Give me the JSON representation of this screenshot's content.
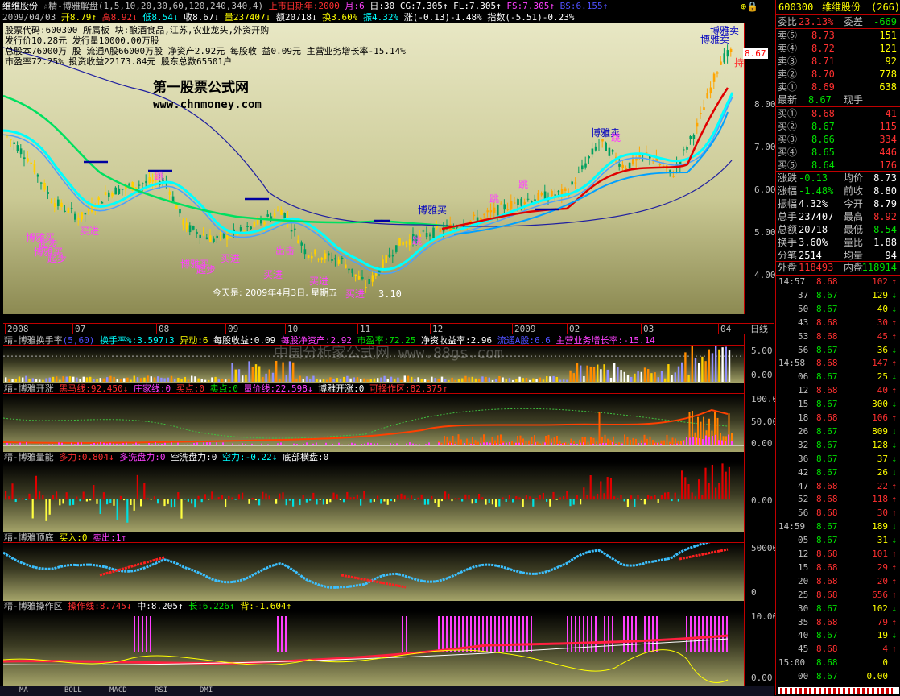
{
  "header": {
    "line1": [
      {
        "t": "维维股份",
        "c": "#ffffff"
      },
      {
        "t": " ☆精-博雅解盘(1,5,10,20,30,60,120,240,340,4)",
        "c": "#c0c0c0"
      },
      {
        "t": " 上市日期年:2000",
        "c": "#ff3030"
      },
      {
        "t": " 月:6",
        "c": "#ff40ff"
      },
      {
        "t": " 日:30",
        "c": "#ffffff"
      },
      {
        "t": " CG:7.305↑",
        "c": "#ffffff"
      },
      {
        "t": " FL:7.305↑",
        "c": "#ffffff"
      },
      {
        "t": " FS:7.305↑",
        "c": "#ff40ff"
      },
      {
        "t": " BS:6.155↑",
        "c": "#5050ff"
      }
    ],
    "line2": [
      {
        "t": "2009/04/03",
        "c": "#c0c0c0"
      },
      {
        "t": " 开8.79↑",
        "c": "#ffff00"
      },
      {
        "t": " 高8.92↓",
        "c": "#ff3030"
      },
      {
        "t": " 低8.54↓",
        "c": "#00ffff"
      },
      {
        "t": " 收8.67↓",
        "c": "#ffffff"
      },
      {
        "t": " 量237407↓",
        "c": "#ffff00"
      },
      {
        "t": " 额20718↓",
        "c": "#ffffff"
      },
      {
        "t": " 换3.60%",
        "c": "#ffff00"
      },
      {
        "t": " 振4.32%",
        "c": "#00ffff"
      },
      {
        "t": " 涨(-0.13)-1.48%",
        "c": "#ffffff"
      },
      {
        "t": " 指数(-5.51)-0.23%",
        "c": "#ffffff"
      }
    ]
  },
  "info_lines": [
    "股票代码:600300 所属板 块:酿酒食品,江苏,农业龙头,外资开购",
    "发行价10.28元  发行量10000.00万股",
    "总股本76000万 股  流通A股66000万股    净资产2.92元   每股收 益0.09元   主营业务增长率-15.14%",
    "市盈率72.25%  投资收益22173.84元  股东总数65501户"
  ],
  "watermark": {
    "title": "第一股票公式网",
    "url": "www.chnmoney.com",
    "mid": "中国分析家公式网 www.88gs.com"
  },
  "annotations": {
    "today": "今天是: 2009年4月3日, 星期五",
    "low_value": "3.10",
    "buy": "买进",
    "boya_buy": "博雅买",
    "boya_sell": "博雅卖",
    "start": "起步",
    "tiao": "跳",
    "chuji": "出击",
    "hold": "持",
    "price_tag": "8.67"
  },
  "main_axis": {
    "labels": [
      "8.00",
      "7.00",
      "6.00",
      "5.00",
      "4.00"
    ]
  },
  "x_axis": {
    "labels": [
      "2008",
      "07",
      "08",
      "09",
      "10",
      "11",
      "12",
      "2009",
      "02",
      "03",
      "04"
    ],
    "period": "日线"
  },
  "panels": [
    {
      "key": "turnover",
      "title": [
        {
          "t": "精-博雅换手率",
          "c": "#c0c0c0"
        },
        {
          "t": "(5,60)",
          "c": "#5050ff"
        },
        {
          "t": "  换手率%:3.597↓3",
          "c": "#00ffff"
        },
        {
          "t": "  异动:6",
          "c": "#ffff00"
        },
        {
          "t": "  每股收益:0.09",
          "c": "#ffffff"
        },
        {
          "t": "  每股净资产:2.92",
          "c": "#ff40ff"
        },
        {
          "t": "  市盈率:72.25",
          "c": "#00e000"
        },
        {
          "t": "  净资收益率:2.96",
          "c": "#ffffff"
        },
        {
          "t": "  流通A股:6.6",
          "c": "#5050ff"
        },
        {
          "t": "  主营业务增长率:-15.14",
          "c": "#ff40ff"
        }
      ],
      "axis": [
        "5.00",
        "0.00"
      ]
    },
    {
      "key": "kaizhang",
      "title": [
        {
          "t": "精-博雅开涨",
          "c": "#c0c0c0"
        },
        {
          "t": "  黑马线:92.450↓",
          "c": "#ff3030"
        },
        {
          "t": "  庄家线:0",
          "c": "#ff40ff"
        },
        {
          "t": "  买点:0",
          "c": "#ff3030"
        },
        {
          "t": "  卖点:0",
          "c": "#00e000"
        },
        {
          "t": "  量价线:22.598↓",
          "c": "#ff40ff"
        },
        {
          "t": "  博雅开涨:0",
          "c": "#ffffff"
        },
        {
          "t": "  可操作区:82.375↑",
          "c": "#ff3030"
        }
      ],
      "axis": [
        "100.00",
        "50.00",
        "0.00"
      ]
    },
    {
      "key": "liangneng",
      "title": [
        {
          "t": "精-博雅量能",
          "c": "#c0c0c0"
        },
        {
          "t": "  多力:0.804↓",
          "c": "#ff3030"
        },
        {
          "t": "  多洗盘力:0",
          "c": "#ff40ff"
        },
        {
          "t": "  空洗盘力:0",
          "c": "#ffffff"
        },
        {
          "t": "  空力:-0.22↓",
          "c": "#00ffff"
        },
        {
          "t": "  底部横盘:0",
          "c": "#ffffff"
        }
      ],
      "axis": [
        "0.00"
      ]
    },
    {
      "key": "dingdi",
      "title": [
        {
          "t": "精-博雅顶底",
          "c": "#c0c0c0"
        },
        {
          "t": "  买入:0",
          "c": "#ffff00"
        },
        {
          "t": "  卖出:1↑",
          "c": "#ff40ff"
        }
      ],
      "axis": [
        "50000",
        "0"
      ]
    },
    {
      "key": "caozuo",
      "title": [
        {
          "t": "精-博雅操作区",
          "c": "#c0c0c0"
        },
        {
          "t": "  操作线:8.745↓",
          "c": "#ff3030"
        },
        {
          "t": "  中:8.205↑",
          "c": "#ffffff"
        },
        {
          "t": "  长:6.226↑",
          "c": "#00e000"
        },
        {
          "t": "  背:-1.604↑",
          "c": "#ffff00"
        }
      ],
      "axis": [
        "10.00",
        "0.00"
      ]
    }
  ],
  "bottom_tabs": [
    "MA",
    "BOLL",
    "MACD",
    "RSI",
    "DMI"
  ],
  "quote": {
    "code": "600300",
    "name": "维维股份",
    "count": "(266)",
    "wei_bi": {
      "label": "委比",
      "value": "23.13%"
    },
    "wei_cha": {
      "label": "委差",
      "value": "-669"
    },
    "asks": [
      {
        "label": "卖⑤",
        "price": "8.73",
        "vol": "151"
      },
      {
        "label": "卖④",
        "price": "8.72",
        "vol": "121"
      },
      {
        "label": "卖③",
        "price": "8.71",
        "vol": "92"
      },
      {
        "label": "卖②",
        "price": "8.70",
        "vol": "778"
      },
      {
        "label": "卖①",
        "price": "8.69",
        "vol": "638"
      }
    ],
    "latest": {
      "label": "最新",
      "price": "8.67",
      "label2": "现手"
    },
    "bids": [
      {
        "label": "买①",
        "price": "8.68",
        "vol": "41"
      },
      {
        "label": "买②",
        "price": "8.67",
        "vol": "115"
      },
      {
        "label": "买③",
        "price": "8.66",
        "vol": "334"
      },
      {
        "label": "买④",
        "price": "8.65",
        "vol": "446"
      },
      {
        "label": "买⑤",
        "price": "8.64",
        "vol": "176"
      }
    ],
    "stats": [
      {
        "l1": "涨跌",
        "v1": "-0.13",
        "l2": "均价",
        "v2": "8.73",
        "c1": "#00e000",
        "c2": "#ffffff"
      },
      {
        "l1": "涨幅",
        "v1": "-1.48%",
        "l2": "前收",
        "v2": "8.80",
        "c1": "#00e000",
        "c2": "#ffffff"
      },
      {
        "l1": "振幅",
        "v1": "4.32%",
        "l2": "今开",
        "v2": "8.79",
        "c1": "#ffffff",
        "c2": "#ffffff"
      },
      {
        "l1": "总手",
        "v1": "237407",
        "l2": "最高",
        "v2": "8.92",
        "c1": "#ffffff",
        "c2": "#ff3030"
      },
      {
        "l1": "总额",
        "v1": "20718",
        "l2": "最低",
        "v2": "8.54",
        "c1": "#ffffff",
        "c2": "#00e000"
      },
      {
        "l1": "换手",
        "v1": "3.60%",
        "l2": "量比",
        "v2": "1.88",
        "c1": "#ffffff",
        "c2": "#ffffff"
      },
      {
        "l1": "分笔",
        "v1": "2514",
        "l2": "均量",
        "v2": "94",
        "c1": "#ffffff",
        "c2": "#ffffff"
      }
    ],
    "outer": {
      "label": "外盘",
      "value": "118493"
    },
    "inner": {
      "label": "内盘",
      "value": "118914"
    },
    "ticks": [
      {
        "t": "14:57",
        "p": "8.68",
        "v": "102",
        "a": "↑"
      },
      {
        "t": "37",
        "p": "8.67",
        "v": "129",
        "a": "↓"
      },
      {
        "t": "50",
        "p": "8.67",
        "v": "40",
        "a": "↓"
      },
      {
        "t": "43",
        "p": "8.68",
        "v": "30",
        "a": "↑"
      },
      {
        "t": "53",
        "p": "8.68",
        "v": "45",
        "a": "↑"
      },
      {
        "t": "56",
        "p": "8.67",
        "v": "36",
        "a": "↓"
      },
      {
        "t": "14:58",
        "p": "8.68",
        "v": "147",
        "a": "↑"
      },
      {
        "t": "06",
        "p": "8.67",
        "v": "25",
        "a": "↓"
      },
      {
        "t": "12",
        "p": "8.68",
        "v": "40",
        "a": "↑"
      },
      {
        "t": "15",
        "p": "8.67",
        "v": "300",
        "a": "↓"
      },
      {
        "t": "18",
        "p": "8.68",
        "v": "106",
        "a": "↑"
      },
      {
        "t": "26",
        "p": "8.67",
        "v": "809",
        "a": "↓"
      },
      {
        "t": "32",
        "p": "8.67",
        "v": "128",
        "a": "↓"
      },
      {
        "t": "36",
        "p": "8.67",
        "v": "37",
        "a": "↓"
      },
      {
        "t": "42",
        "p": "8.67",
        "v": "26",
        "a": "↓"
      },
      {
        "t": "47",
        "p": "8.68",
        "v": "22",
        "a": "↑"
      },
      {
        "t": "52",
        "p": "8.68",
        "v": "118",
        "a": "↑"
      },
      {
        "t": "56",
        "p": "8.68",
        "v": "30",
        "a": "↑"
      },
      {
        "t": "14:59",
        "p": "8.67",
        "v": "189",
        "a": "↓"
      },
      {
        "t": "05",
        "p": "8.67",
        "v": "31",
        "a": "↓"
      },
      {
        "t": "12",
        "p": "8.68",
        "v": "101",
        "a": "↑"
      },
      {
        "t": "15",
        "p": "8.68",
        "v": "29",
        "a": "↑"
      },
      {
        "t": "20",
        "p": "8.68",
        "v": "20",
        "a": "↑"
      },
      {
        "t": "25",
        "p": "8.68",
        "v": "656",
        "a": "↑"
      },
      {
        "t": "30",
        "p": "8.67",
        "v": "102",
        "a": "↓"
      },
      {
        "t": "35",
        "p": "8.68",
        "v": "79",
        "a": "↑"
      },
      {
        "t": "40",
        "p": "8.67",
        "v": "19",
        "a": "↓"
      },
      {
        "t": "45",
        "p": "8.68",
        "v": "4",
        "a": "↑"
      },
      {
        "t": "15:00",
        "p": "8.68",
        "v": "0",
        "a": ""
      },
      {
        "t": "00",
        "p": "8.67",
        "v": "0.00",
        "a": ""
      }
    ]
  },
  "colors": {
    "up": "#ff3030",
    "down": "#00ffff",
    "frame": "#c00000"
  }
}
